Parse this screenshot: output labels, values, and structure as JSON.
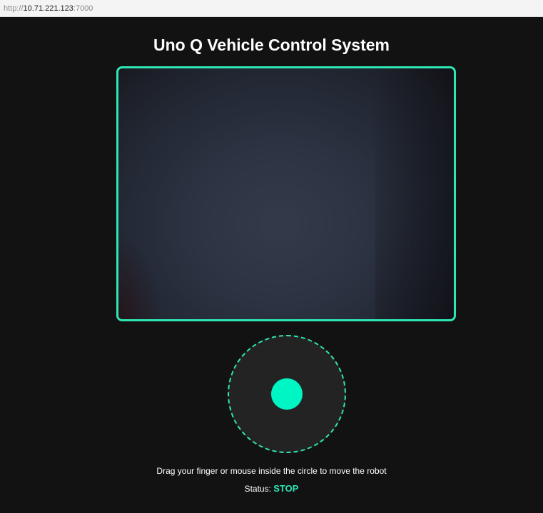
{
  "browser": {
    "url_scheme": "http://",
    "url_host": "10.71.221.123",
    "url_port": ":7000"
  },
  "page": {
    "title": "Uno Q Vehicle Control System",
    "instructions": "Drag your finger or mouse inside the circle to move the robot",
    "status_label": "Status:",
    "status_value": "STOP"
  },
  "colors": {
    "accent": "#2ee6b4",
    "knob": "#00f5c4",
    "background": "#121212",
    "joystick_base": "#232323"
  }
}
